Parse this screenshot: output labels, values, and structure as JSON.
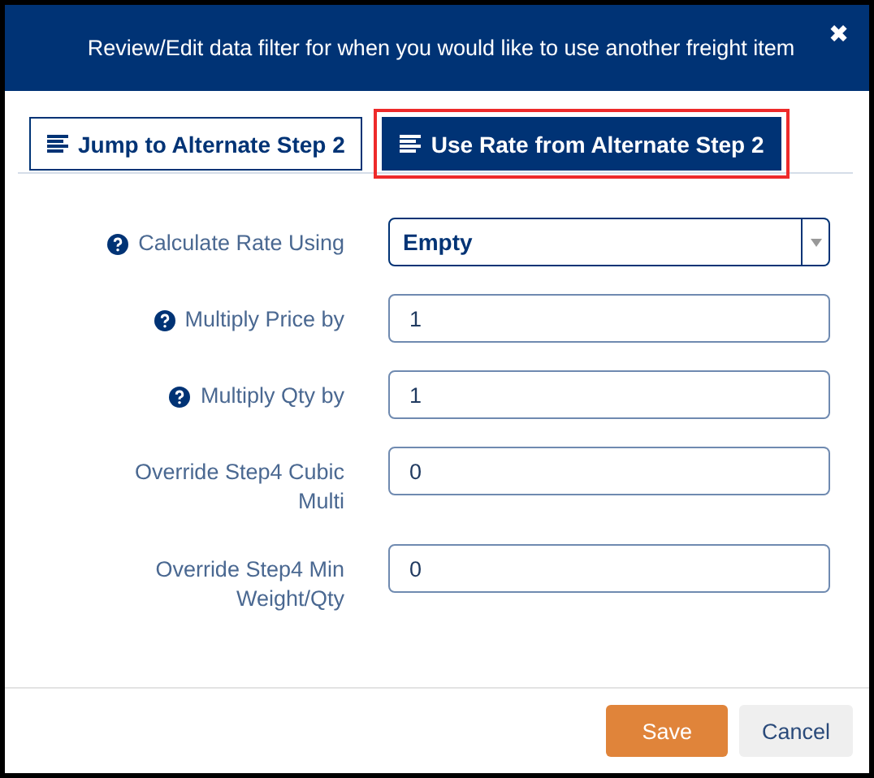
{
  "dialog": {
    "title": "Review/Edit data filter for when you would like to use another freight item",
    "close": "✖"
  },
  "tabs": [
    {
      "label": "Jump to Alternate Step 2",
      "selected": false,
      "highlighted": false
    },
    {
      "label": "Use Rate from Alternate Step 2",
      "selected": true,
      "highlighted": true
    }
  ],
  "fields": [
    {
      "label": "Calculate Rate Using",
      "help": true,
      "kind": "select",
      "value": "Empty"
    },
    {
      "label": "Multiply Price by",
      "help": true,
      "kind": "text",
      "value": "1"
    },
    {
      "label": "Multiply Qty by",
      "help": true,
      "kind": "text",
      "value": "1"
    },
    {
      "label": "Override Step4 Cubic Multi",
      "help": false,
      "kind": "text",
      "value": "0"
    },
    {
      "label": "Override Step4 Min Weight/Qty",
      "help": false,
      "kind": "text",
      "value": "0"
    }
  ],
  "buttons": [
    {
      "label": "Save",
      "kind": "primary"
    },
    {
      "label": "Cancel",
      "kind": "secondary"
    }
  ]
}
